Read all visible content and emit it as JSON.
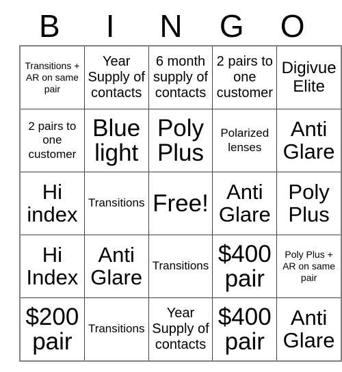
{
  "card": {
    "title_letters": [
      "B",
      "I",
      "N",
      "G",
      "O"
    ],
    "free_space": "Free!",
    "columns": 5,
    "rows": 5,
    "grid": [
      [
        {
          "text": "Transitions + AR on same pair",
          "size": "xs"
        },
        {
          "text": "Year Supply of contacts",
          "size": "m"
        },
        {
          "text": "6 month supply of contacts",
          "size": "m"
        },
        {
          "text": "2 pairs to one customer",
          "size": "m"
        },
        {
          "text": "Digivue Elite",
          "size": "l"
        }
      ],
      [
        {
          "text": "2 pairs to one customer",
          "size": "s"
        },
        {
          "text": "Blue light",
          "size": "xxl"
        },
        {
          "text": "Poly Plus",
          "size": "xxl"
        },
        {
          "text": "Polarized lenses",
          "size": "s"
        },
        {
          "text": "Anti Glare",
          "size": "xl"
        }
      ],
      [
        {
          "text": "Hi index",
          "size": "xl"
        },
        {
          "text": "Transitions",
          "size": "s"
        },
        {
          "text": "Free!",
          "size": "xxl"
        },
        {
          "text": "Anti Glare",
          "size": "xl"
        },
        {
          "text": "Poly Plus",
          "size": "xl"
        }
      ],
      [
        {
          "text": "Hi Index",
          "size": "xl"
        },
        {
          "text": "Anti Glare",
          "size": "xl"
        },
        {
          "text": "Transitions",
          "size": "s"
        },
        {
          "text": "$400 pair",
          "size": "xxl"
        },
        {
          "text": "Poly Plus + AR on same pair",
          "size": "xs"
        }
      ],
      [
        {
          "text": "$200 pair",
          "size": "xxl"
        },
        {
          "text": "Transitions",
          "size": "s"
        },
        {
          "text": "Year Supply of contacts",
          "size": "m"
        },
        {
          "text": "$400 pair",
          "size": "xxl"
        },
        {
          "text": "Anti Glare",
          "size": "xl"
        }
      ]
    ]
  },
  "colors": {
    "background": "#ffffff",
    "text": "#000000",
    "grid_line": "#404040",
    "outer_border": "#808080"
  }
}
